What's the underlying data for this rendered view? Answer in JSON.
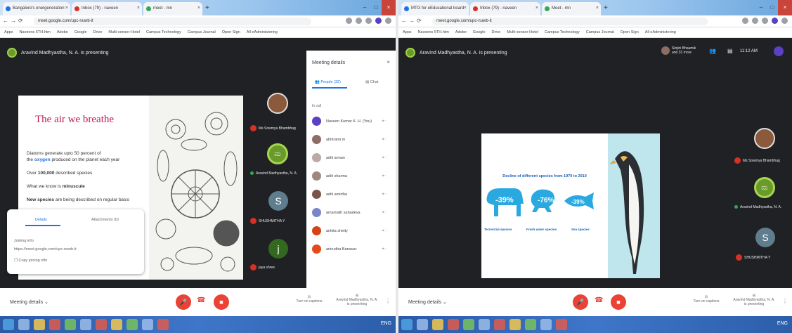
{
  "left": {
    "tabs": [
      {
        "label": "Bangalore's energeneration"
      },
      {
        "label": "Inbox (79) - naveen"
      },
      {
        "label": "meet - mn"
      }
    ],
    "url": "meet.google.com/upc-nuwb-it",
    "bookmarks": [
      "Apps",
      "Naveens 5TH.htm",
      "Adobe",
      "Google",
      "Drive",
      "Multi-sensor-Hotel",
      "Campus Technology",
      "Campus Journal",
      "Open Sign",
      "All eAdministering"
    ],
    "presenter": "Aravind Madhyastha, N. A. is presenting",
    "slide": {
      "title": "The air we breathe",
      "line1": "Diatoms generate upto 50 percent of",
      "line2_pre": "the",
      "line2_kw": "oxygen",
      "line2_post": "produced on the planet each year",
      "line3_pre": "Over",
      "line3_kw": "100,000",
      "line3_post": "described species",
      "line4_pre": "What we know is",
      "line4_kw": "minuscule",
      "line5_kw": "New species",
      "line5_post": "are being described on regular basis"
    },
    "joining": {
      "tab_details": "Details",
      "tab_attachments": "Attachments (0)",
      "title": "Joining info",
      "link": "https://meet.google.com/upc-nuwb-it",
      "copy": "Copy joining info"
    },
    "tiles": [
      {
        "name": "Ms Sowmya Bhambhag"
      },
      {
        "name": "Aravind Madhyastha, N. A."
      },
      {
        "name": "SHUSHMITHA Y",
        "initial": "S"
      },
      {
        "name": "jaya shree",
        "initial": "j"
      }
    ],
    "panel": {
      "title": "Meeting details",
      "tab_people": "People (32)",
      "tab_chat": "Chat",
      "section": "In call",
      "people": [
        "Naveen Kumar K. H. (You)",
        "abhirami m",
        "aditi annan",
        "aditi sharma",
        "aditi amirtha",
        "amarnath sahadeva",
        "ankita shetty",
        "anirudha Banavar"
      ]
    },
    "bottom": {
      "details": "Meeting details",
      "present_label": "Turn on captions",
      "presenting_label": "Aravind Madhyastha, N. A.",
      "presenting_sub": "is presenting"
    }
  },
  "right": {
    "tabs": [
      {
        "label": "MTG for eEducational board"
      },
      {
        "label": "Inbox (79) - naveen"
      },
      {
        "label": "Meet - mn"
      }
    ],
    "url": "meet.google.com/upc-nuwb-it",
    "bookmarks": [
      "Apps",
      "Naveens 5TH.htm",
      "Adobe",
      "Google",
      "Drive",
      "Multi-sensor-Hotel",
      "Campus Technology",
      "Campus Journal",
      "Open Sign",
      "All eAdministering"
    ],
    "presenter": "Aravind Madhyastha, N. A. is presenting",
    "header_user": "Sinjini Bhaumik",
    "header_user_sub": "and 31 more",
    "clock": "11:12 AM",
    "slide": {
      "title": "Decline of different species from 1970 to 2010",
      "items": [
        {
          "pct": "-39%",
          "label": "Terrestrial species"
        },
        {
          "pct": "-76%",
          "label": "Fresh water species"
        },
        {
          "pct": "-39%",
          "label": "Sea species"
        }
      ]
    },
    "tiles": [
      {
        "name": "Ms Sowmya Bhambhag"
      },
      {
        "name": "Aravind Madhyastha, N. A."
      },
      {
        "name": "SHUSHMITHA Y",
        "initial": "S"
      }
    ],
    "bottom": {
      "details": "Meeting details",
      "present_label": "Turn on captions",
      "presenting_label": "Aravind Madhyastha, N. A.",
      "presenting_sub": "is presenting"
    }
  },
  "colors": {
    "accent": "#1a73e8",
    "end_call": "#ea4335",
    "slide_title": "#c2185b",
    "keyword": "#1a73e8",
    "meet_bg": "#202124"
  },
  "tray_left": "ENG",
  "tray_right": "ENG"
}
